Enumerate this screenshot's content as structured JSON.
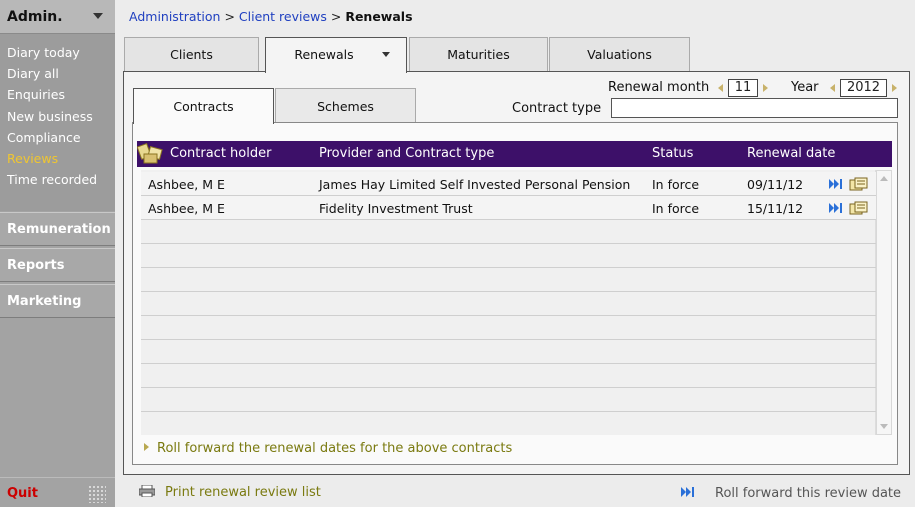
{
  "sidebar": {
    "title": "Admin.",
    "items": [
      {
        "label": "Diary today"
      },
      {
        "label": "Diary all"
      },
      {
        "label": "Enquiries"
      },
      {
        "label": "New business"
      },
      {
        "label": "Compliance"
      },
      {
        "label": "Reviews",
        "active": true
      },
      {
        "label": "Time recorded"
      }
    ],
    "sections": [
      "Remuneration",
      "Reports",
      "Marketing"
    ],
    "quit_label": "Quit"
  },
  "breadcrumb": {
    "part1": "Administration",
    "sep1": " > ",
    "part2": "Client reviews",
    "sep2": " > ",
    "current": "Renewals"
  },
  "tabs": [
    "Clients",
    "Renewals",
    "Maturities",
    "Valuations"
  ],
  "filters": {
    "renewal_month_label": "Renewal month",
    "renewal_month_value": "11",
    "year_label": "Year",
    "year_value": "2012",
    "contract_type_label": "Contract type",
    "contract_type_value": ""
  },
  "subtabs": [
    "Contracts",
    "Schemes"
  ],
  "table": {
    "columns": [
      "Contract holder",
      "Provider and Contract type",
      "Status",
      "Renewal date"
    ],
    "rows": [
      {
        "holder": "Ashbee, M E",
        "provider": "James Hay Limited Self Invested Personal Pension",
        "status": "In force",
        "date": "09/11/12"
      },
      {
        "holder": "Ashbee, M E",
        "provider": "Fidelity Investment Trust",
        "status": "In force",
        "date": "15/11/12"
      }
    ]
  },
  "roll_forward_contracts": "Roll forward the renewal dates for the above contracts",
  "footer": {
    "print_label": "Print renewal review list",
    "roll_label": "Roll forward this review date"
  },
  "colors": {
    "header_bg": "#3d1069",
    "active_nav": "#f0c630",
    "link": "#7a7a10",
    "quit": "#cc0000"
  }
}
